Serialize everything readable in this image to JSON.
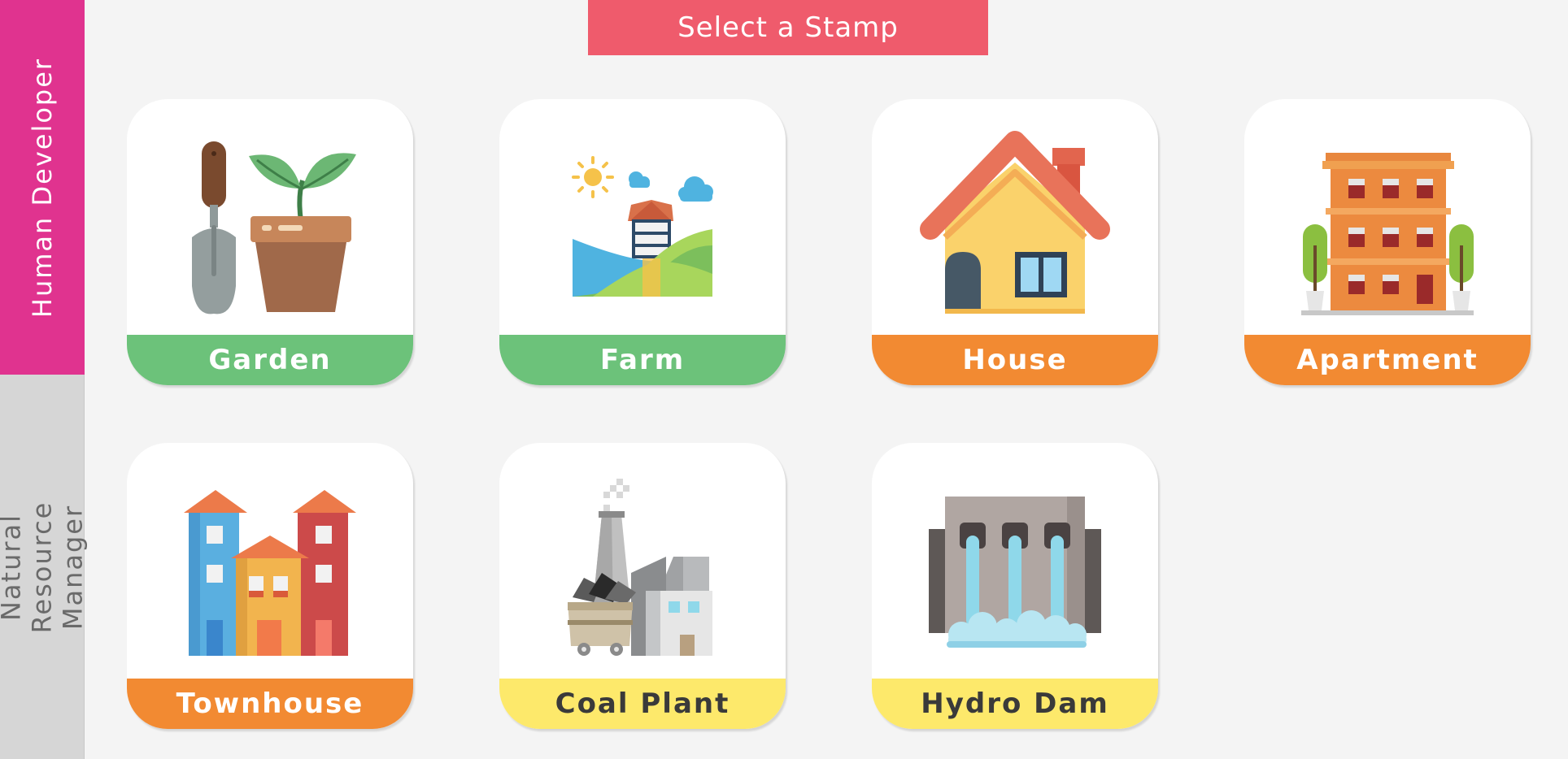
{
  "colors": {
    "background": "#f4f4f4",
    "human_tab": "#e0338f",
    "resource_tab": "#d6d6d6",
    "header": "#ef5b6c",
    "green": "#6cc27a",
    "orange": "#f28a32",
    "yellow": "#fde96b",
    "dark_text": "#3a3a3a"
  },
  "sidebar": {
    "tabs": [
      {
        "label": "Human Developer",
        "active": true
      },
      {
        "label": "Natural Resource Manager",
        "active": false
      }
    ]
  },
  "header": {
    "title": "Select a Stamp"
  },
  "stamps": [
    {
      "label": "Garden",
      "icon": "garden-icon",
      "color": "#6cc27a"
    },
    {
      "label": "Farm",
      "icon": "farm-icon",
      "color": "#6cc27a"
    },
    {
      "label": "House",
      "icon": "house-icon",
      "color": "#f28a32"
    },
    {
      "label": "Apartment",
      "icon": "apartment-icon",
      "color": "#f28a32"
    },
    {
      "label": "Townhouse",
      "icon": "townhouse-icon",
      "color": "#f28a32"
    },
    {
      "label": "Coal Plant",
      "icon": "coal-plant-icon",
      "color": "#fde96b"
    },
    {
      "label": "Hydro Dam",
      "icon": "hydro-dam-icon",
      "color": "#fde96b"
    }
  ]
}
